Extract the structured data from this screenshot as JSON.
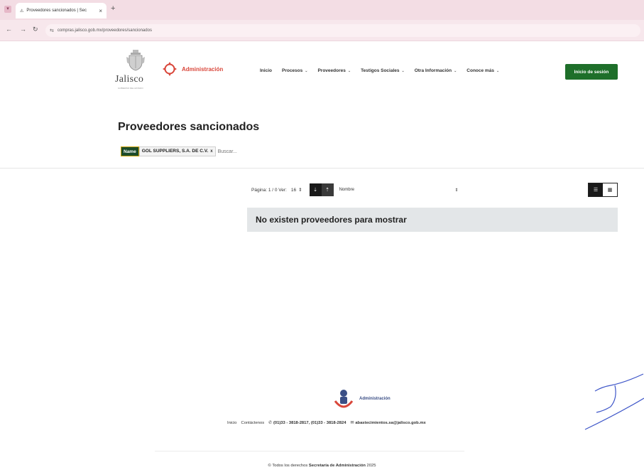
{
  "browser": {
    "tab_title": "Proveedores sancionados | Sec",
    "tab_close": "×",
    "new_tab": "+",
    "url": "compras.jalisco.gob.mx/proveedores/sancionados"
  },
  "header": {
    "jalisco_logo_text": "Jalisco",
    "jalisco_logo_sub": "GOBIERNO DEL ESTADO",
    "admin_logo_text": "Administración",
    "nav": [
      {
        "label": "Inicio",
        "caret": ""
      },
      {
        "label": "Procesos",
        "caret": "⌄"
      },
      {
        "label": "Proveedores",
        "caret": "⌄"
      },
      {
        "label": "Testigos Sociales",
        "caret": "⌄"
      },
      {
        "label": "Otra Información",
        "caret": "⌄"
      },
      {
        "label": "Conoce más",
        "caret": "⌄"
      }
    ],
    "login_label": "Inicio de sesión"
  },
  "main": {
    "title": "Proveedores sancionados",
    "filter": {
      "tag": "Name",
      "value": "GOL SUPPLIERS, S.A. DE C.V.",
      "remove": "x",
      "search_placeholder": "Buscar..."
    },
    "toolbar": {
      "page_info": "Página: 1 / 0 Ver:",
      "per_page": "16",
      "sort_field": "Nombre"
    },
    "empty_message": "No existen proveedores para mostrar"
  },
  "footer": {
    "admin_logo_text": "Administración",
    "links": {
      "inicio": "Inicio",
      "contactenos": "Contáctenos",
      "phones": "(01)33 - 3818-2817, (01)33 - 3818-2824",
      "email": "abastecimientos.sa@jalisco.gob.mx"
    },
    "copyright_prefix": "© Todos los derechos",
    "copyright_org": "Secretaría de Administración",
    "copyright_year": "2025"
  },
  "colors": {
    "login_button": "#1e6f2a",
    "admin_red": "#d9473b",
    "filter_tag": "#1b4b2a",
    "empty_box": "#e3e6e8",
    "tabbar": "#f3dde4"
  }
}
